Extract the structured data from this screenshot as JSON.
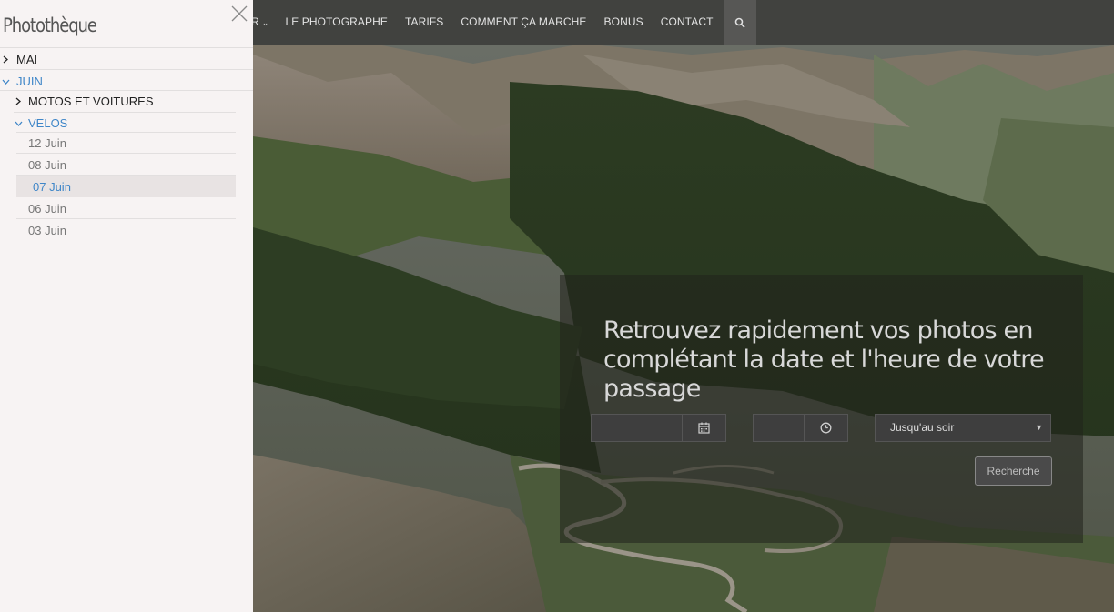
{
  "colors": {
    "accent": "#3f86c8",
    "sidebar_bg": "#f7f3f3",
    "nav_bg": "#3e3e3c",
    "panel_bg": "#20221c"
  },
  "nav": {
    "partial_item_label": "R",
    "items": [
      "LE PHOTOGRAPHE",
      "TARIFS",
      "COMMENT ÇA MARCHE",
      "BONUS",
      "CONTACT"
    ],
    "search_icon": "search-icon"
  },
  "sidebar": {
    "title": "Photothèque",
    "close_icon": "close-icon",
    "tree": {
      "mai": "MAI",
      "juin": "JUIN",
      "motos": "MOTOS ET VOITURES",
      "velos": "VELOS",
      "dates": [
        "12 Juin",
        "08 Juin",
        "07 Juin",
        "06 Juin",
        "03 Juin"
      ],
      "selected_date": "07 Juin"
    }
  },
  "search": {
    "title": "Retrouvez rapidement vos photos en complétant la date et l'heure de votre passage",
    "date_value": "",
    "time_value": "",
    "calendar_icon": "calendar-icon",
    "clock_icon": "clock-icon",
    "until_select": "Jusqu'au soir",
    "button_label": "Recherche"
  }
}
